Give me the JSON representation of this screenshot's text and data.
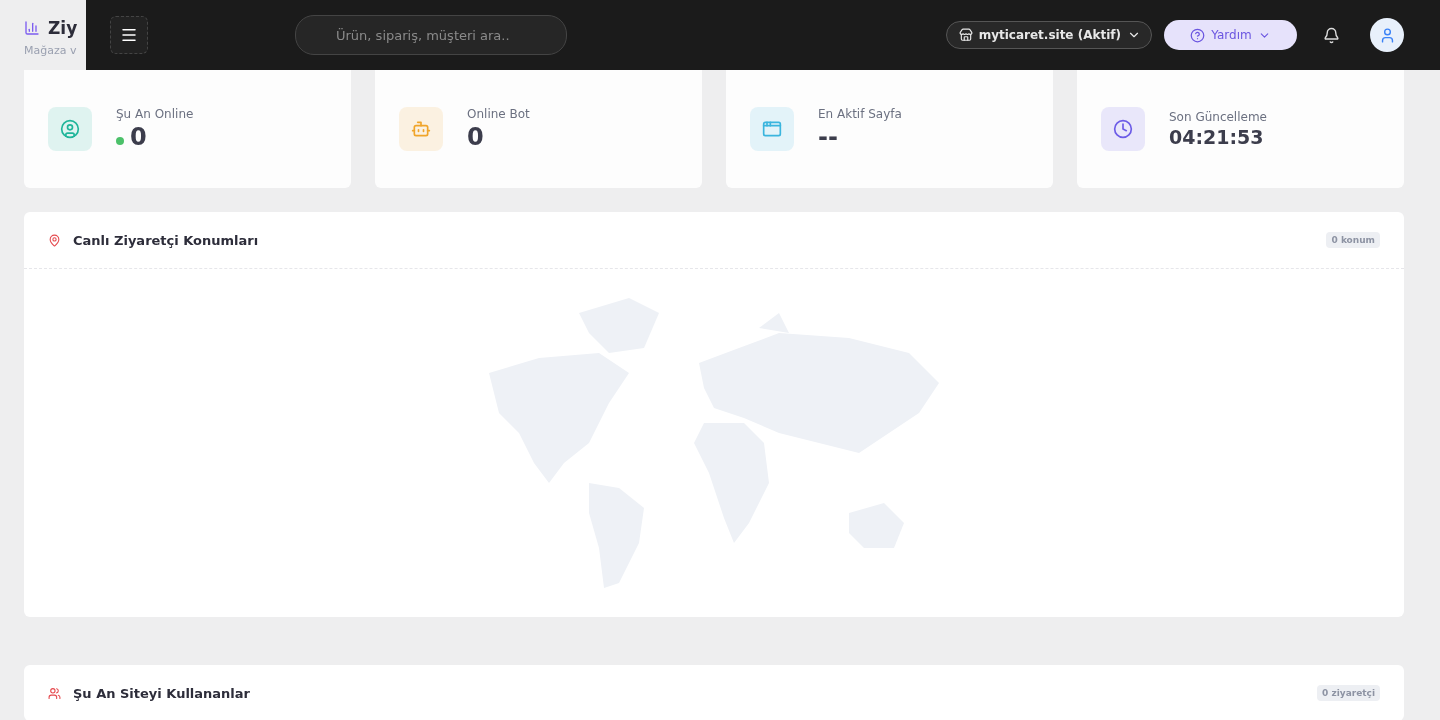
{
  "page_header": {
    "title": "Ziy",
    "subtitle": "Mağaza v"
  },
  "topbar": {
    "search": {
      "placeholder": "Ürün, sipariş, müşteri ara.."
    },
    "store_selector": "myticaret.site (Aktif)",
    "help_button": "Yardım"
  },
  "stats": [
    {
      "kind": "live",
      "color": "#1fb59a",
      "label": "Şu An Online",
      "value": "0"
    },
    {
      "kind": "plain",
      "color": "#f0a52a",
      "label": "Online Bot",
      "value": "0"
    },
    {
      "kind": "plain",
      "color": "#3bb5de",
      "label": "En Aktif Sayfa",
      "value": "--"
    },
    {
      "kind": "plain",
      "color": "#6c5ce7",
      "label": "Son Güncelleme",
      "value": "04:21:53"
    }
  ],
  "locations_panel": {
    "title": "Canlı Ziyaretçi Konumları",
    "badge": "0 konum"
  },
  "visitors_panel": {
    "title": "Şu An Siteyi Kullananlar",
    "badge": "0 ziyaretçi"
  }
}
